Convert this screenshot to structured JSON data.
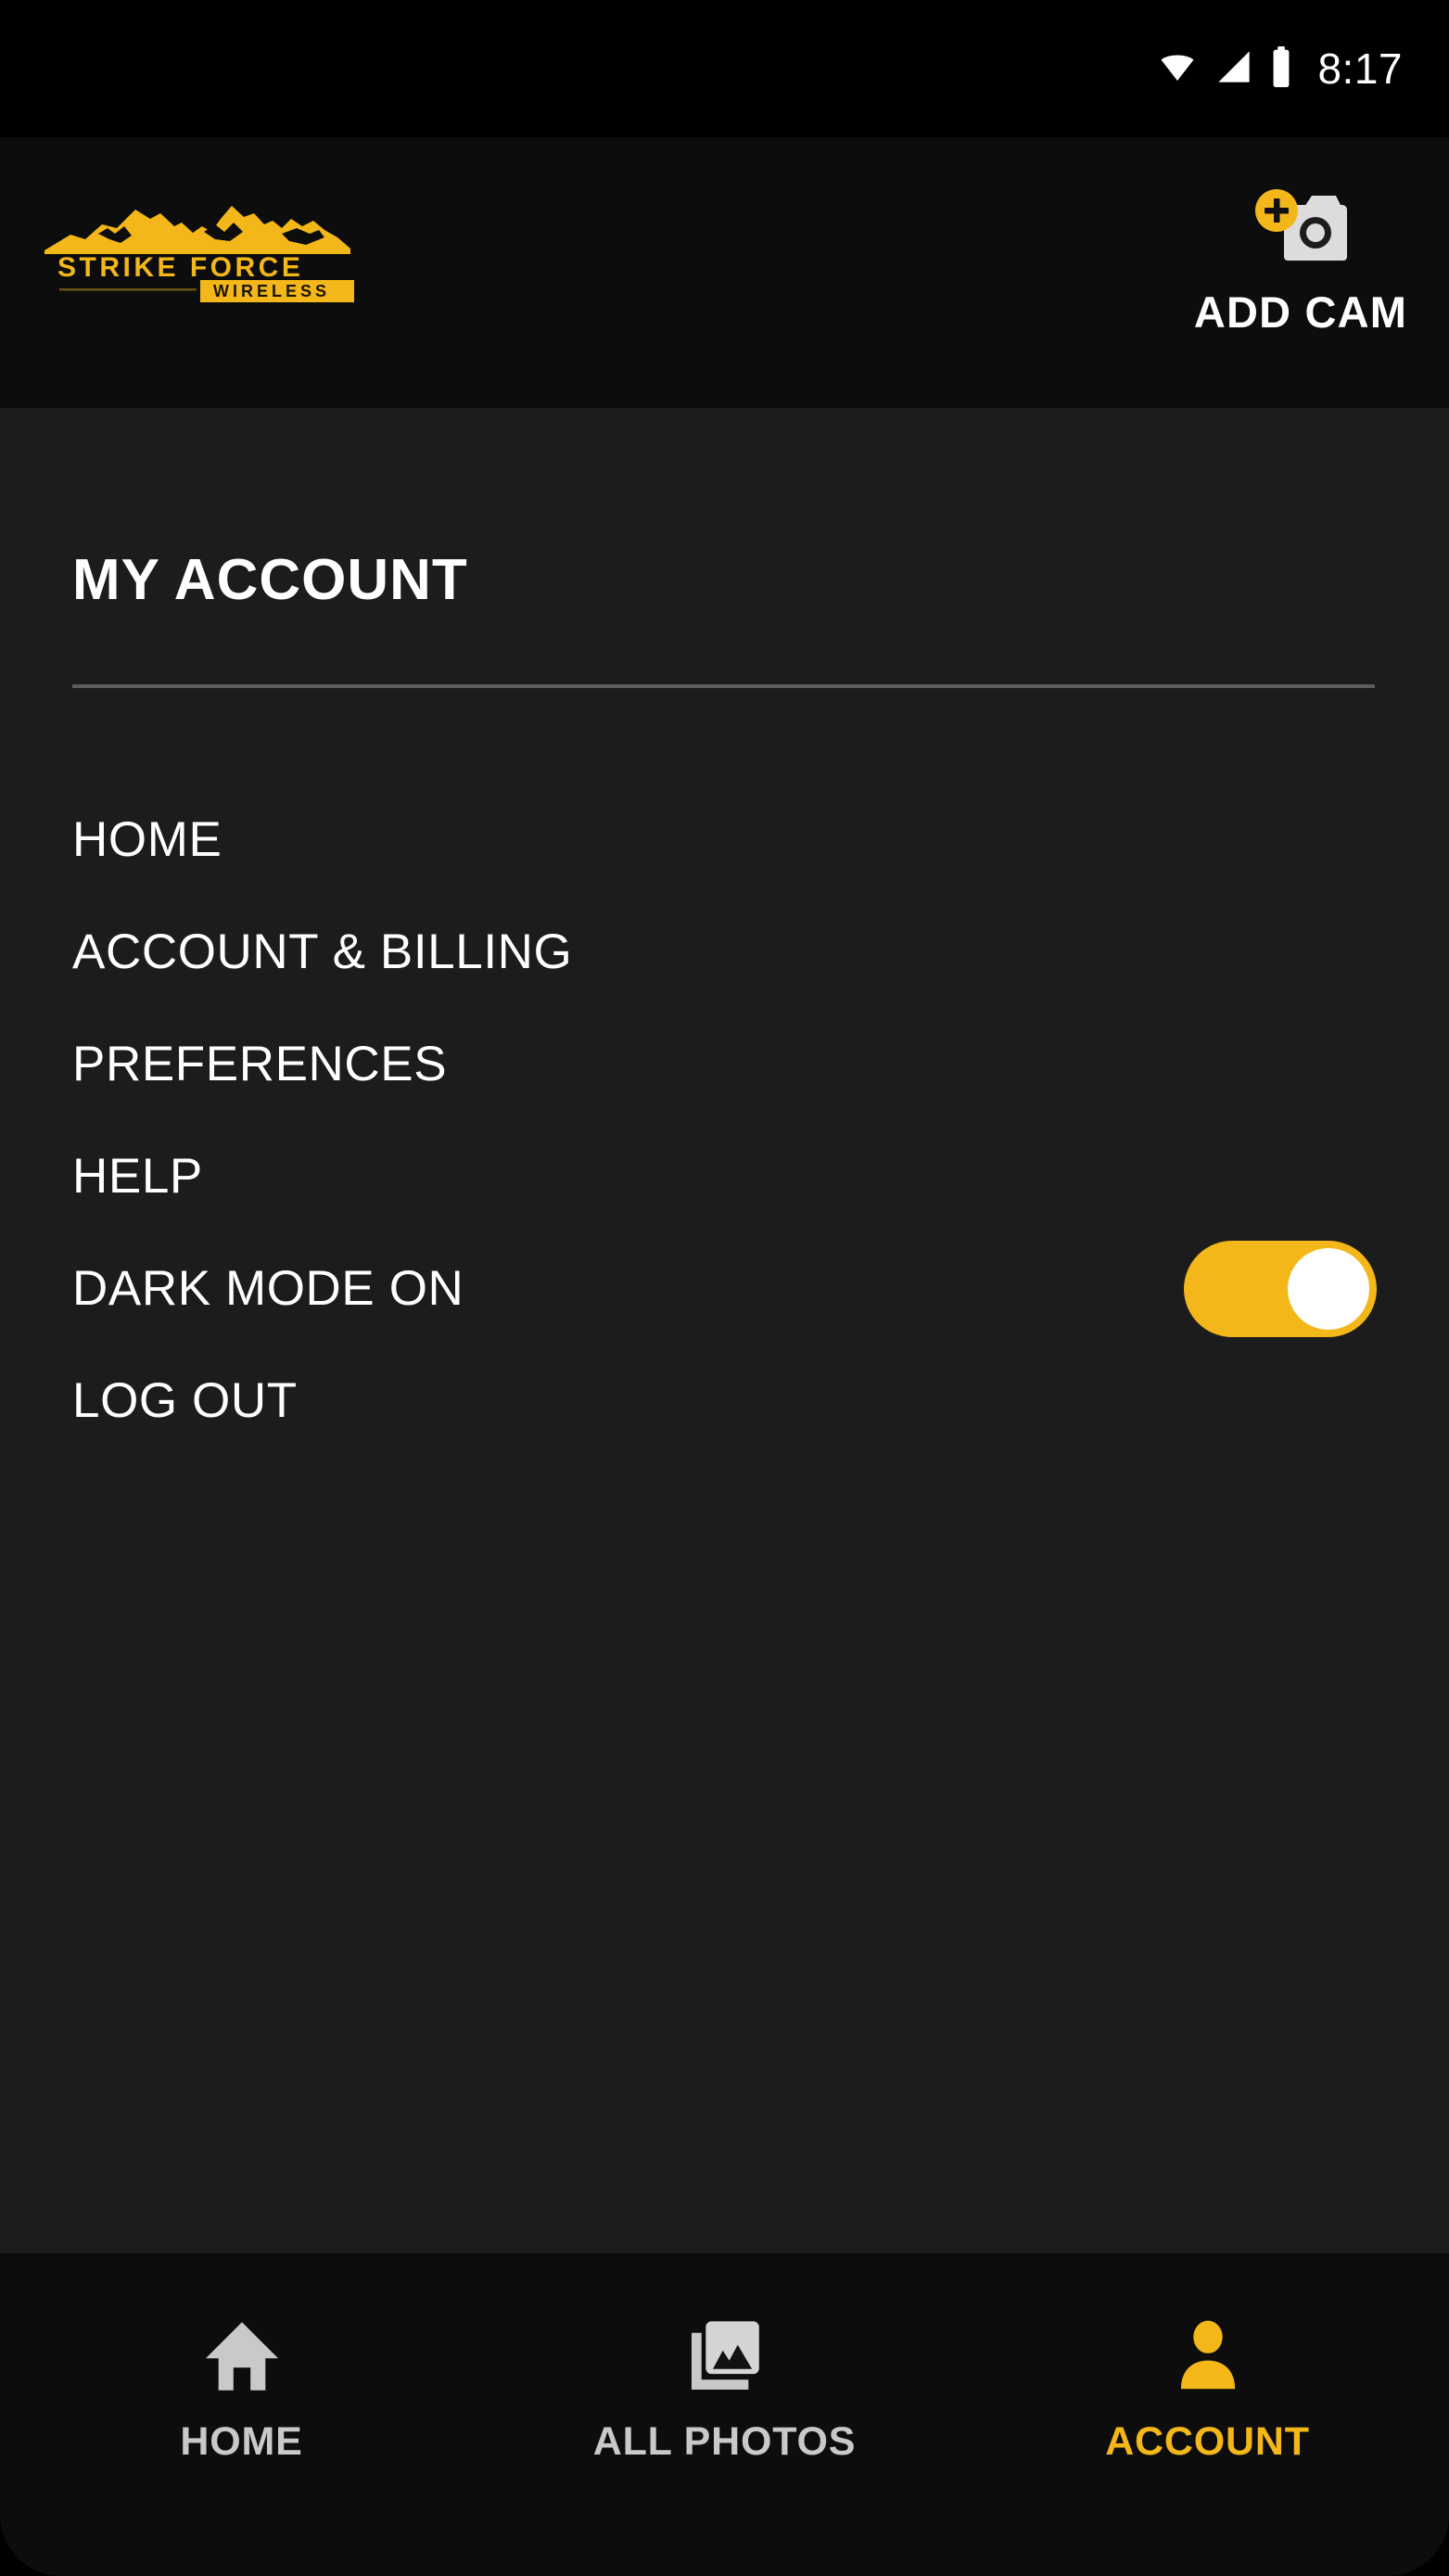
{
  "status_bar": {
    "time": "8:17",
    "icons": [
      "wifi-icon",
      "cellular-signal-icon",
      "battery-icon"
    ]
  },
  "header": {
    "logo": {
      "name": "strike-force-wireless-logo",
      "line1": "STRIKE FORCE",
      "line2": "WIRELESS"
    },
    "add_cam": {
      "label": "ADD CAM",
      "icon": "add-camera-icon"
    }
  },
  "main": {
    "title": "MY ACCOUNT",
    "subline": "",
    "menu_items": [
      {
        "label": "HOME",
        "name": "home"
      },
      {
        "label": "ACCOUNT & BILLING",
        "name": "account-billing"
      },
      {
        "label": "PREFERENCES",
        "name": "preferences"
      },
      {
        "label": "HELP",
        "name": "help"
      },
      {
        "label": "DARK MODE ON",
        "name": "dark-mode",
        "toggle": true,
        "toggle_on": true
      },
      {
        "label": "LOG OUT",
        "name": "log-out"
      }
    ]
  },
  "bottom_nav": [
    {
      "label": "HOME",
      "icon": "home-icon",
      "active": false
    },
    {
      "label": "ALL PHOTOS",
      "icon": "photos-icon",
      "active": false
    },
    {
      "label": "ACCOUNT",
      "icon": "person-icon",
      "active": true
    }
  ],
  "colors": {
    "accent": "#f4b719",
    "background": "#1c1c1c",
    "chrome": "#0d0d0d",
    "text": "#ffffff",
    "inactive_text": "#c9c9c9"
  }
}
